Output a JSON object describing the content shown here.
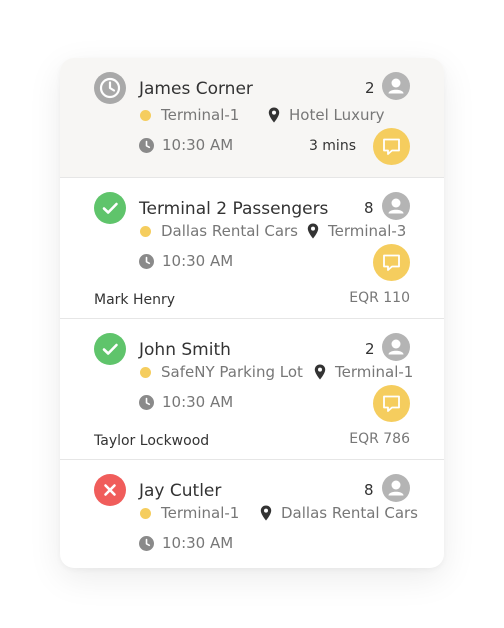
{
  "rides": [
    {
      "status": "pending",
      "status_icon": "clock-icon",
      "name": "James Corner",
      "passengers": "2",
      "from": "Terminal-1",
      "to": "Hotel Luxury",
      "time": "10:30 AM",
      "eta": "3 mins"
    },
    {
      "status": "confirmed",
      "status_icon": "check-icon",
      "name": "Terminal 2 Passengers",
      "passengers": "8",
      "from": "Dallas Rental Cars",
      "to": "Terminal-3",
      "time": "10:30 AM",
      "driver": "Mark Henry",
      "vehicle": "EQR 110"
    },
    {
      "status": "confirmed",
      "status_icon": "check-icon",
      "name": "John Smith",
      "passengers": "2",
      "from": "SafeNY Parking Lot",
      "to": "Terminal-1",
      "time": "10:30 AM",
      "driver": "Taylor Lockwood",
      "vehicle": "EQR 786"
    },
    {
      "status": "cancelled",
      "status_icon": "close-icon",
      "name": "Jay Cutler",
      "passengers": "8",
      "from": "Terminal-1",
      "to": "Dallas Rental Cars",
      "time": "10:30 AM"
    }
  ],
  "colors": {
    "pending": "#a9a9a9",
    "confirmed": "#5fc46b",
    "cancelled": "#f05d5b",
    "accent": "#f5cd5e",
    "highlight_bg": "#f7f6f4",
    "text_dark": "#333333",
    "text_muted": "#777777"
  }
}
